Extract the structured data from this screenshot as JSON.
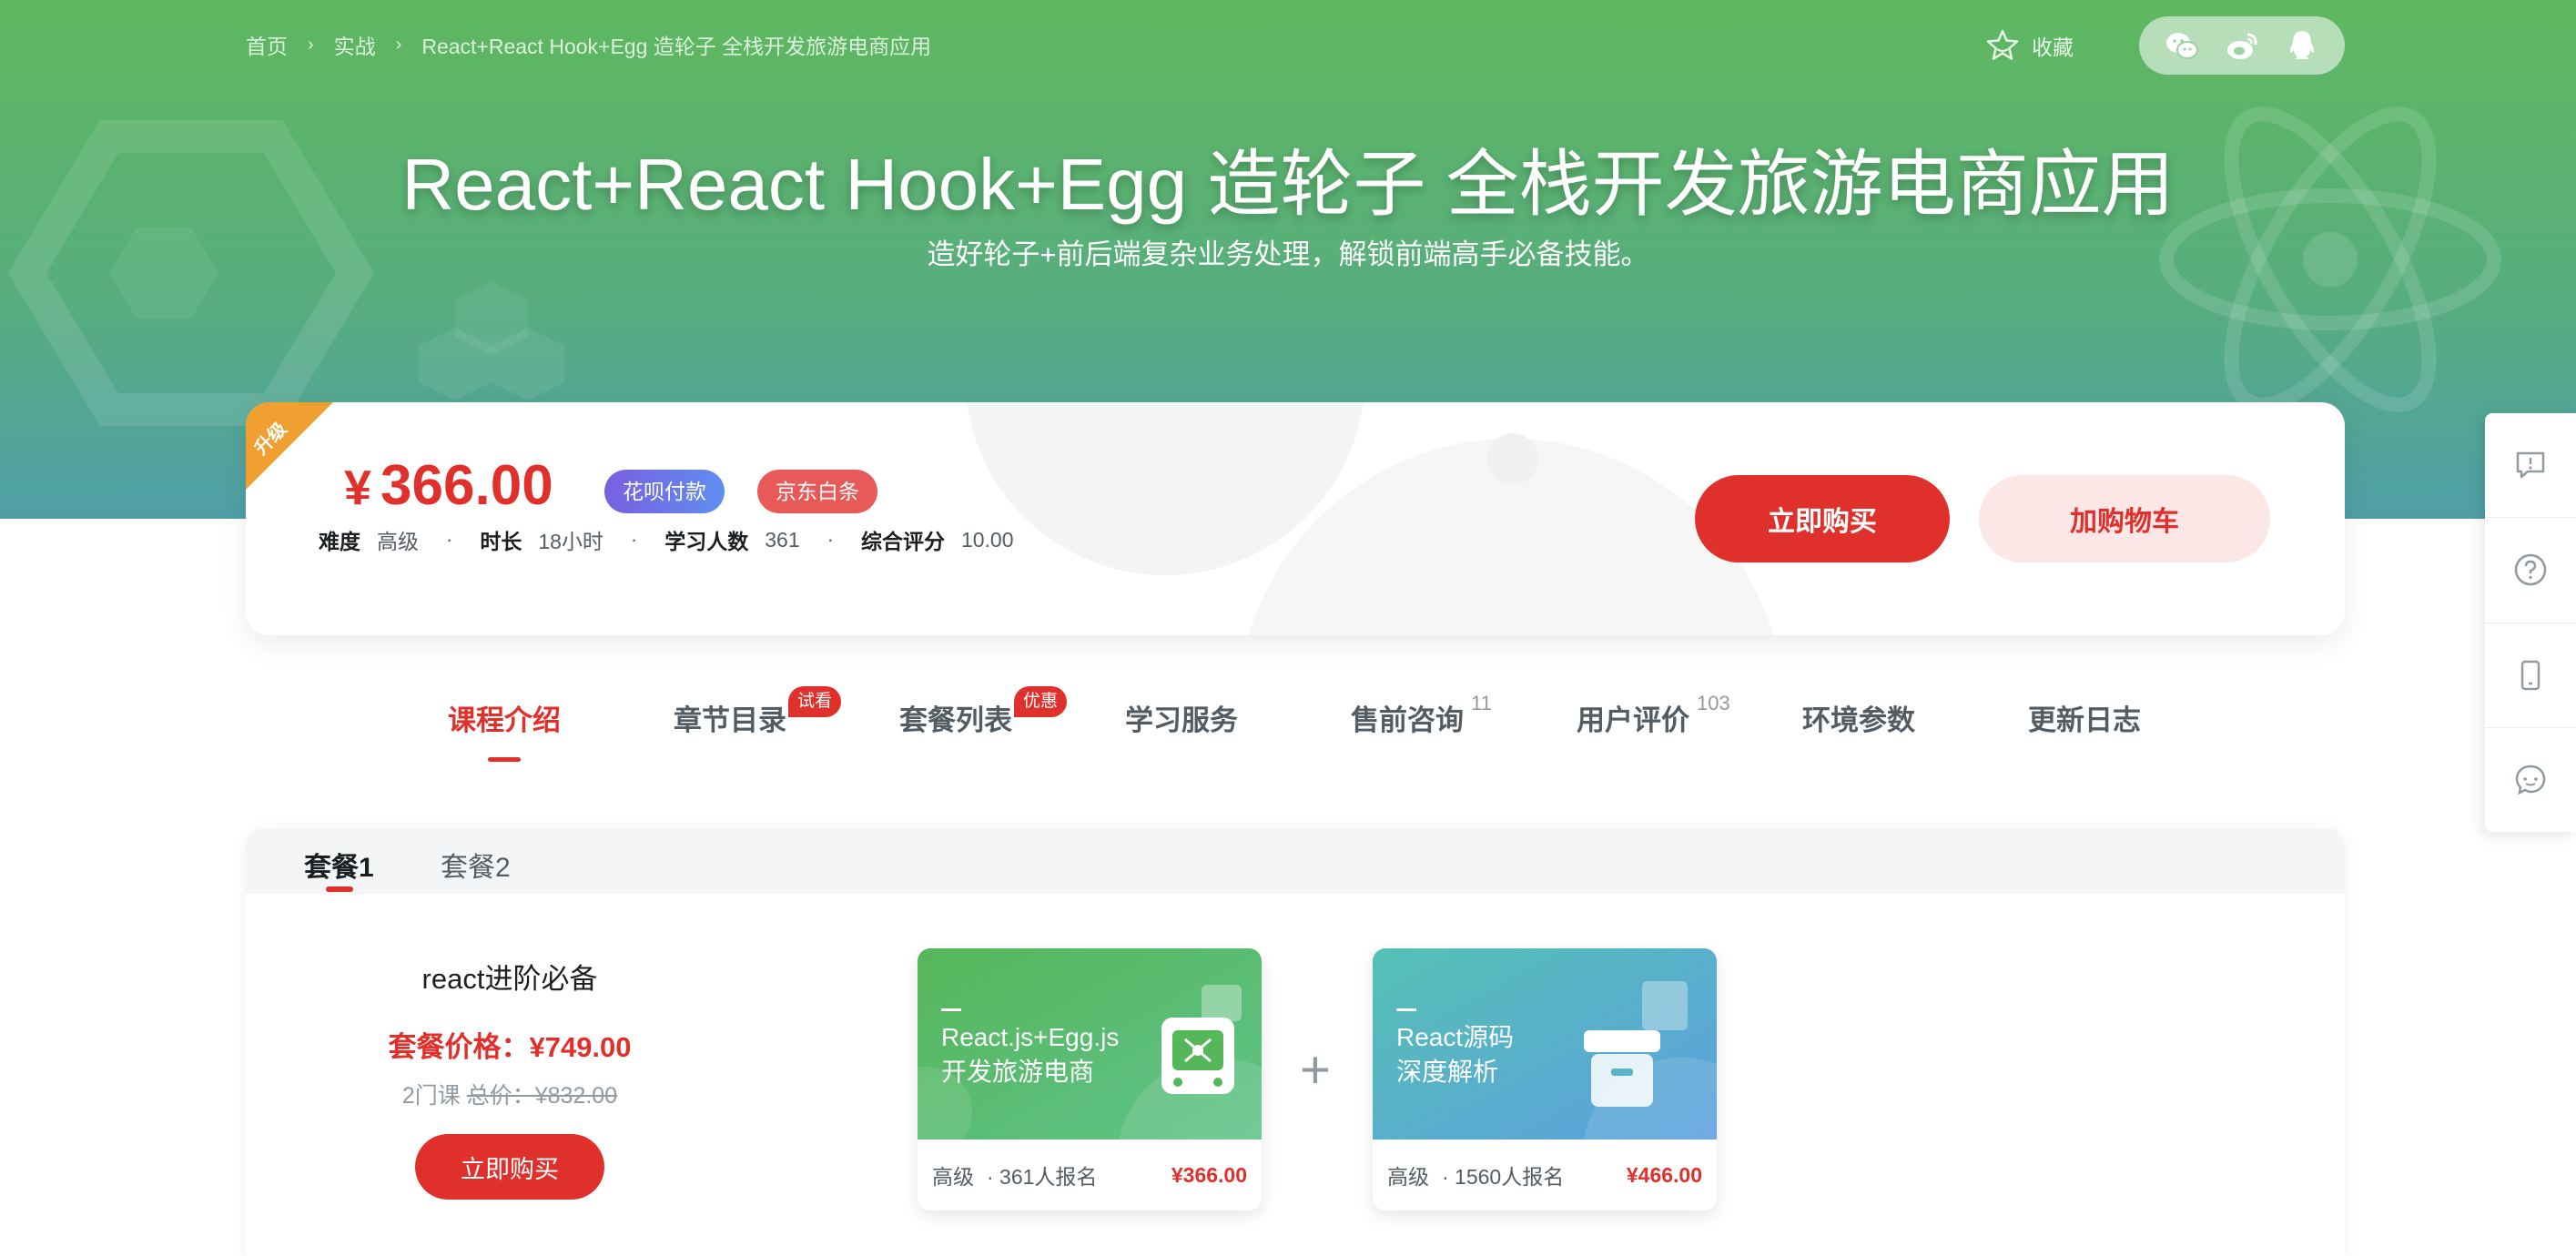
{
  "breadcrumb": {
    "items": [
      "首页",
      "实战",
      "React+React Hook+Egg 造轮子 全栈开发旅游电商应用"
    ],
    "separator": "›"
  },
  "header": {
    "favorite_label": "收藏",
    "share_icons": [
      "wechat-icon",
      "weibo-icon",
      "qq-icon"
    ]
  },
  "hero": {
    "title": "React+React Hook+Egg 造轮子 全栈开发旅游电商应用",
    "subtitle": "造好轮子+前后端复杂业务处理，解锁前端高手必备技能。"
  },
  "price_card": {
    "ribbon": "升级",
    "currency": "¥",
    "price": "366.00",
    "badges": [
      "花呗付款",
      "京东白条"
    ],
    "meta": [
      {
        "label": "难度",
        "value": "高级"
      },
      {
        "label": "时长",
        "value": "18小时"
      },
      {
        "label": "学习人数",
        "value": "361"
      },
      {
        "label": "综合评分",
        "value": "10.00"
      }
    ],
    "buy_label": "立即购买",
    "cart_label": "加购物车"
  },
  "tabs": [
    {
      "label": "课程介绍",
      "active": true
    },
    {
      "label": "章节目录",
      "badge": "试看"
    },
    {
      "label": "套餐列表",
      "badge": "优惠"
    },
    {
      "label": "学习服务"
    },
    {
      "label": "售前咨询",
      "count": "11"
    },
    {
      "label": "用户评价",
      "count": "103"
    },
    {
      "label": "环境参数"
    },
    {
      "label": "更新日志"
    }
  ],
  "side_toolbar": [
    "feedback-icon",
    "help-icon",
    "mobile-icon",
    "chat-icon"
  ],
  "packages": {
    "tabs": [
      "套餐1",
      "套餐2"
    ],
    "active": 0,
    "name": "react进阶必备",
    "price_text": "套餐价格：¥749.00",
    "course_count": "2门课",
    "total_text": "总价：¥832.00",
    "buy_label": "立即购买",
    "plus": "+",
    "courses": [
      {
        "title_line1": "React.js+Egg.js",
        "title_line2": "开发旅游电商",
        "level": "高级",
        "enrolled": "· 361人报名",
        "price": "¥366.00",
        "color_from": "#56b65a",
        "color_to": "#8fd0a0"
      },
      {
        "title_line1": "React源码",
        "title_line2": "深度解析",
        "level": "高级",
        "enrolled": "· 1560人报名",
        "price": "¥466.00",
        "color_from": "#55c1b4",
        "color_to": "#5c9fe0"
      }
    ]
  }
}
